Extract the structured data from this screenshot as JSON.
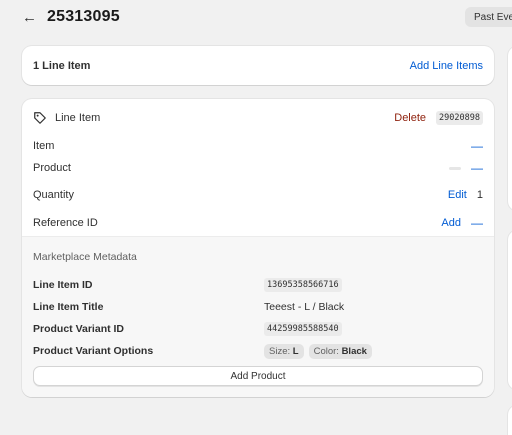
{
  "header": {
    "title": "25313095",
    "past_events_label": "Past Eve"
  },
  "summary": {
    "title": "1 Line Item",
    "add_link": "Add Line Items"
  },
  "line_item": {
    "heading": "Line Item",
    "delete_label": "Delete",
    "id_code": "29020898",
    "fields": {
      "item_label": "Item",
      "item_value": "—",
      "product_label": "Product",
      "product_value": "—",
      "quantity_label": "Quantity",
      "quantity_edit": "Edit",
      "quantity_value": "1",
      "reference_label": "Reference ID",
      "reference_add": "Add",
      "reference_value": "—"
    }
  },
  "metadata": {
    "title": "Marketplace Metadata",
    "line_item_id_label": "Line Item ID",
    "line_item_id": "13695358566716",
    "line_item_title_label": "Line Item Title",
    "line_item_title": "Teeest - L / Black",
    "variant_id_label": "Product Variant ID",
    "variant_id": "44259985588540",
    "variant_options_label": "Product Variant Options",
    "size_key": "Size:",
    "size_value": "L",
    "color_key": "Color:",
    "color_value": "Black",
    "add_product_label": "Add Product"
  },
  "icons": {
    "back": "arrow-left-icon",
    "tag": "tag-icon"
  },
  "colors": {
    "link": "#005bd3",
    "delete": "#8e1f0b",
    "background": "#f1f1f1"
  }
}
